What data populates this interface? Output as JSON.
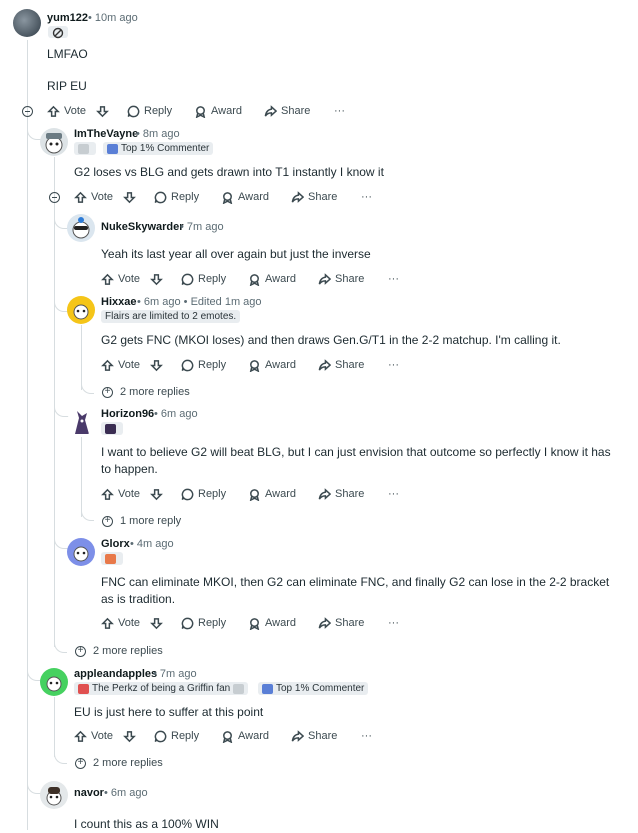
{
  "actions": {
    "vote": "Vote",
    "reply": "Reply",
    "award": "Award",
    "share": "Share",
    "more": "···"
  },
  "comments": [
    {
      "user": "yum122",
      "time": "10m ago",
      "flairs": [],
      "body": [
        "LMFAO",
        "RIP EU"
      ]
    },
    {
      "user": "ImTheVayne",
      "time": "8m ago",
      "flairs": [
        "",
        "Top 1% Commenter"
      ],
      "body": [
        "G2 loses vs BLG and gets drawn into T1 instantly I know it"
      ]
    },
    {
      "user": "NukeSkywarder",
      "time": "7m ago",
      "flairs": [],
      "body": [
        "Yeah its last year all over again but just the inverse"
      ]
    },
    {
      "user": "Hixxae",
      "time": "6m ago",
      "edited": "Edited 1m ago",
      "flairs": [
        "Flairs are limited to 2 emotes."
      ],
      "body": [
        "G2 gets FNC (MKOI loses) and then draws Gen.G/T1 in the 2-2 matchup. I'm calling it."
      ],
      "more_replies": "2 more replies"
    },
    {
      "user": "Horizon96",
      "time": "6m ago",
      "flairs": [],
      "body": [
        "I want to believe G2 will beat BLG, but I can just envision that outcome so perfectly I know it has to happen."
      ],
      "more_replies": "1 more reply"
    },
    {
      "user": "Glorx",
      "time": "4m ago",
      "flairs": [],
      "body": [
        "FNC can eliminate MKOI, then G2 can eliminate FNC, and finally G2 can lose in the 2-2 bracket as is tradition."
      ]
    },
    {
      "user": "appleandapples",
      "time": "7m ago",
      "flairs": [
        "The Perkz of being a Griffin fan",
        "Top 1% Commenter"
      ],
      "body": [
        "EU is just here to suffer at this point"
      ],
      "more_replies": "2 more replies"
    },
    {
      "user": "navor",
      "time": "6m ago",
      "flairs": [],
      "body": [
        "I count this as a 100% WIN"
      ]
    }
  ],
  "thread_more_replies": "2 more replies",
  "colors": {
    "accent": "#0f1a1c",
    "line": "#d7dde0",
    "muted": "#5c6c74"
  }
}
